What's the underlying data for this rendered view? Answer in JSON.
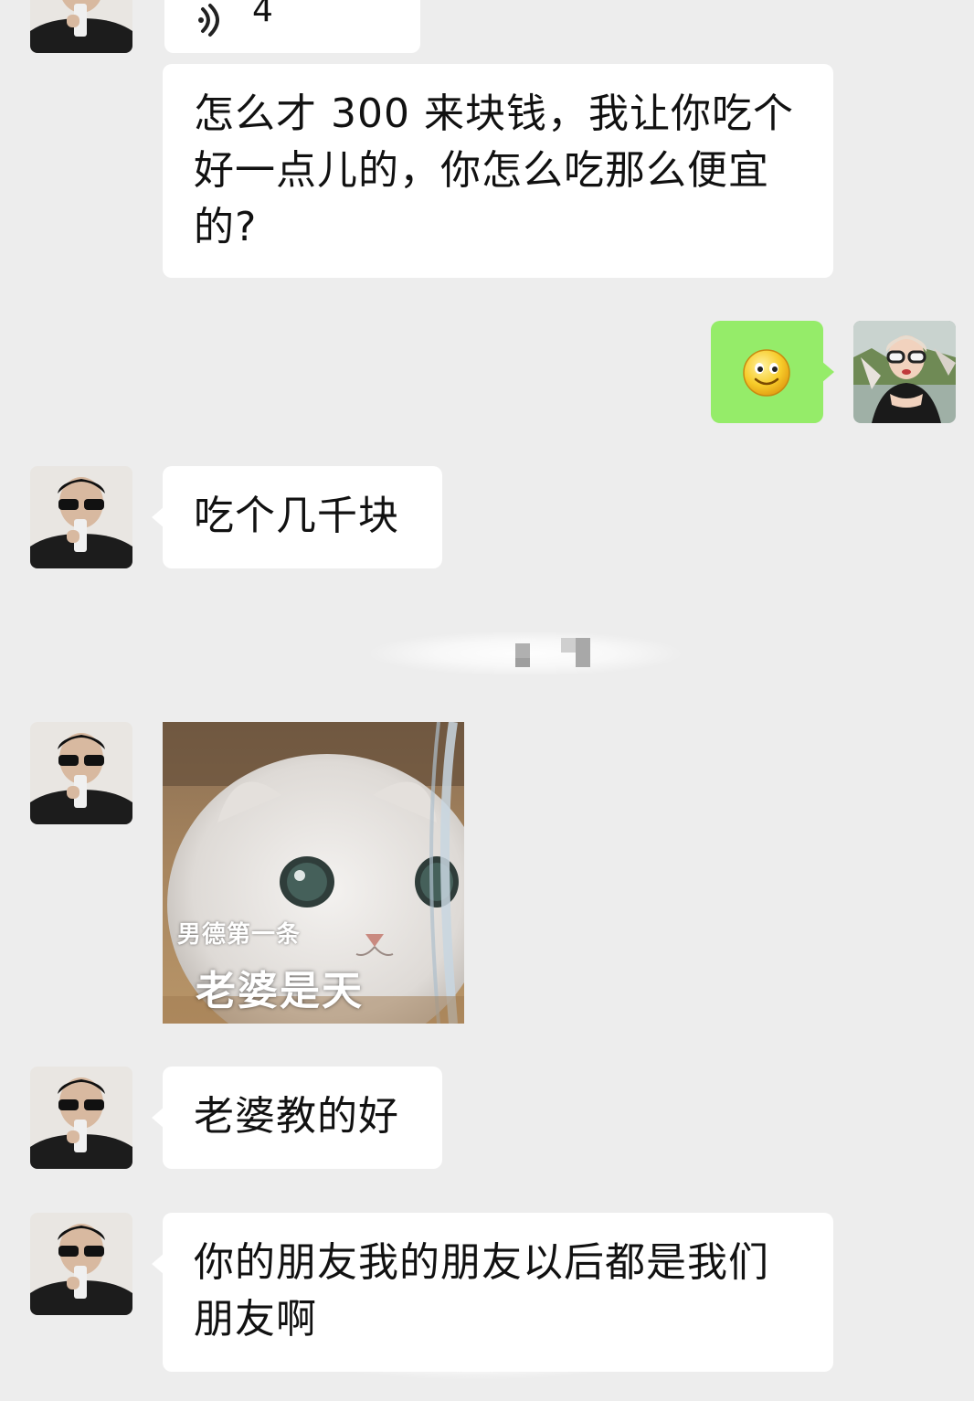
{
  "chat": {
    "voice_message": {
      "duration": "4"
    },
    "messages": [
      {
        "sender": "other",
        "text": "怎么才 300 来块钱，我让你吃个好一点儿的，你怎么吃那么便宜的?"
      },
      {
        "sender": "self",
        "emoji": "smile-emoji"
      },
      {
        "sender": "other",
        "text": "吃个几千块"
      },
      {
        "sender": "other",
        "sticker": {
          "line1": "男德第一条",
          "line2": "老婆是天"
        }
      },
      {
        "sender": "other",
        "text": "老婆教的好"
      },
      {
        "sender": "other",
        "text": "你的朋友我的朋友以后都是我们朋友啊"
      }
    ]
  },
  "colors": {
    "background": "#ededed",
    "bubble_other": "#ffffff",
    "bubble_self": "#95ec69"
  }
}
